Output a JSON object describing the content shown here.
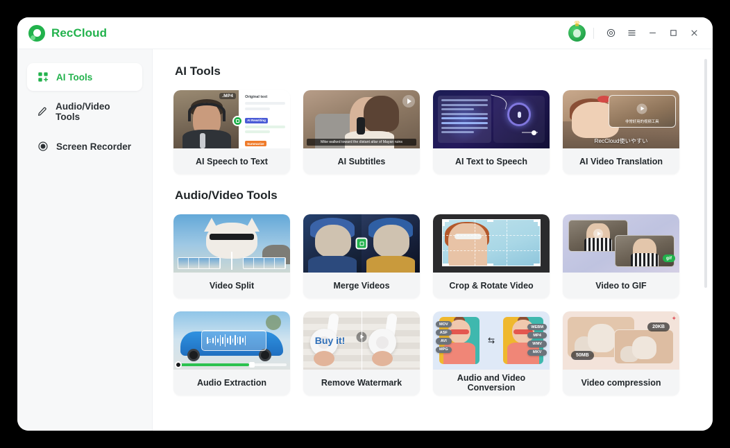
{
  "window": {
    "app_name": "RecCloud",
    "logo_icon": "reccloud-logo-icon",
    "controls": {
      "settings_icon": "gear-icon",
      "menu_icon": "hamburger-menu-icon",
      "minimize_icon": "minimize-icon",
      "maximize_icon": "maximize-icon",
      "close_icon": "close-icon",
      "avatar_icon": "user-avatar-crown-icon"
    }
  },
  "sidebar": {
    "items": [
      {
        "label": "AI Tools",
        "icon": "grid-plus-icon",
        "active": true
      },
      {
        "label": "Audio/Video Tools",
        "icon": "pencil-icon",
        "active": false
      },
      {
        "label": "Screen Recorder",
        "icon": "record-circle-icon",
        "active": false
      }
    ]
  },
  "sections": [
    {
      "title": "AI Tools",
      "cards": [
        {
          "label": "AI Speech to Text",
          "badge": ".MP4",
          "panel_title": "Original text",
          "tag_blue": "AI Rewriting",
          "tag_orange": "Summarize"
        },
        {
          "label": "AI Subtitles",
          "caption": "Mike walked toward the distant altar of Mayan ruins"
        },
        {
          "label": "AI Text to Speech"
        },
        {
          "label": "AI Video Translation",
          "subtitle_jp": "RecCloud使いやすい",
          "inset_cn": "非常好用的视频工具"
        }
      ]
    },
    {
      "title": "Audio/Video Tools",
      "cards": [
        {
          "label": "Video Split"
        },
        {
          "label": "Merge Videos"
        },
        {
          "label": "Crop & Rotate Video"
        },
        {
          "label": "Video to GIF",
          "badge": "gif"
        },
        {
          "label": "Audio Extraction"
        },
        {
          "label": "Remove Watermark",
          "watermark_text": "Buy it!"
        },
        {
          "label": "Audio and Video Conversion",
          "formats_from": [
            "MOV",
            "ASF",
            "AVI",
            "MPG"
          ],
          "formats_to": [
            "WEBM",
            "MP4",
            "WMV",
            "MKV"
          ]
        },
        {
          "label": "Video compression",
          "size_before": "50MB",
          "size_after": "20KB"
        }
      ]
    }
  ],
  "colors": {
    "brand_green": "#22b24c",
    "card_bg": "#f4f5f6",
    "sidebar_bg": "#f7f8f9",
    "text_dark": "#22282c"
  }
}
